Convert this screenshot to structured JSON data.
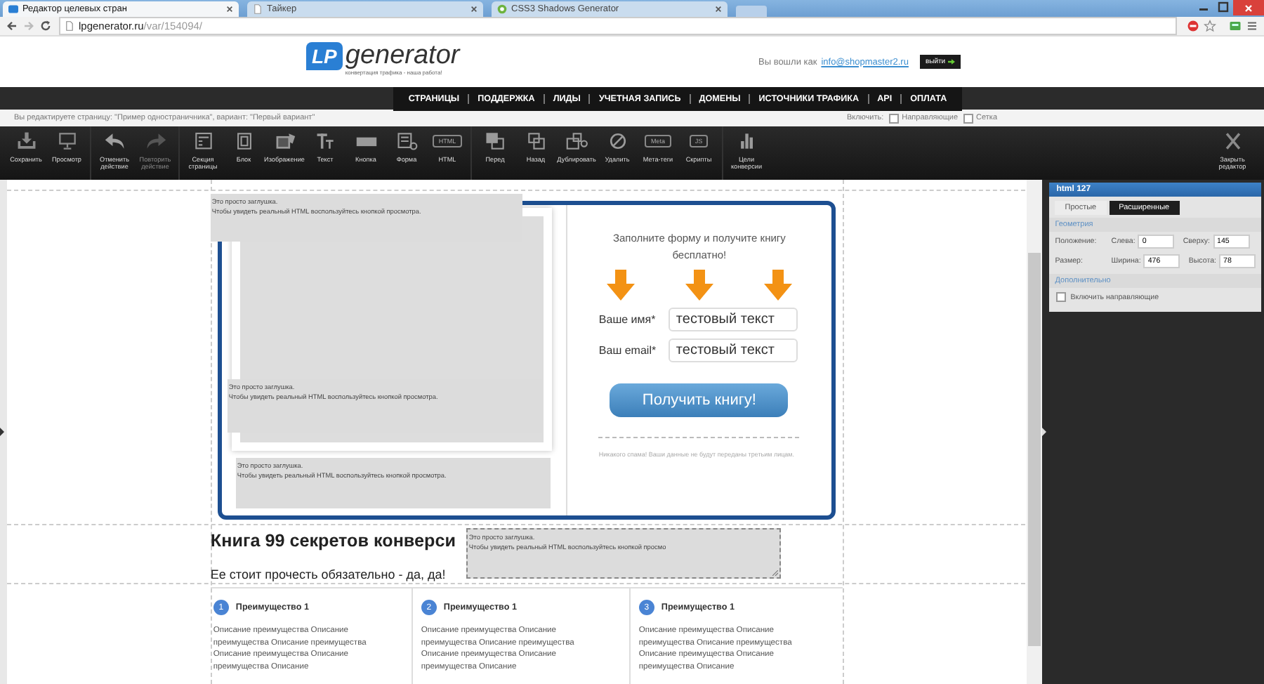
{
  "browser": {
    "tabs": [
      {
        "title": "Редактор целевых стран",
        "selected": true,
        "kind": "lp"
      },
      {
        "title": "Тайкер",
        "selected": false,
        "kind": "page"
      },
      {
        "title": "CSS3 Shadows Generator",
        "selected": false,
        "kind": "green"
      }
    ],
    "address": {
      "host": "lpgenerator.ru",
      "path": "/var/154094/"
    }
  },
  "header": {
    "logo": {
      "mark": "LP",
      "word": "generator",
      "tagline": "конвертация трафика - наша работа!"
    },
    "login_text": "Вы вошли как",
    "email": "info@shopmaster2.ru",
    "logout": "выйти"
  },
  "nav": [
    "СТРАНИЦЫ",
    "ПОДДЕРЖКА",
    "ЛИДЫ",
    "УЧЕТНАЯ ЗАПИСЬ",
    "ДОМЕНЫ",
    "ИСТОЧНИКИ ТРАФИКА",
    "API",
    "ОПЛАТА"
  ],
  "info": {
    "text": "Вы редактируете страницу: \"Пример одностраничника\", вариант: \"Первый вариант\"",
    "toggles_label": "Включить:",
    "toggles": [
      {
        "label": "Направляющие",
        "checked": false
      },
      {
        "label": "Сетка",
        "checked": false
      }
    ]
  },
  "toolbar": {
    "groups": [
      [
        {
          "kind": "save",
          "label": "Сохранить",
          "disabled": false
        },
        {
          "kind": "preview",
          "label": "Просмотр",
          "disabled": false
        }
      ],
      [
        {
          "kind": "undo",
          "label": "Отменить\nдействие",
          "disabled": false
        },
        {
          "kind": "redo",
          "label": "Повторить\nдействие",
          "disabled": true
        }
      ],
      [
        {
          "kind": "section",
          "label": "Секция\nстраницы",
          "disabled": false
        },
        {
          "kind": "block",
          "label": "Блок",
          "disabled": false
        },
        {
          "kind": "image",
          "label": "Изображение",
          "disabled": false
        },
        {
          "kind": "text",
          "label": "Текст",
          "disabled": false
        },
        {
          "kind": "button",
          "label": "Кнопка",
          "disabled": false
        },
        {
          "kind": "form",
          "label": "Форма",
          "disabled": false
        },
        {
          "kind": "badge",
          "badge": "HTML",
          "label": "HTML",
          "disabled": false
        }
      ],
      [
        {
          "kind": "front",
          "label": "Перед",
          "disabled": false
        },
        {
          "kind": "back",
          "label": "Назад",
          "disabled": false
        },
        {
          "kind": "duplicate",
          "label": "Дублировать",
          "disabled": false
        },
        {
          "kind": "delete",
          "label": "Удалить",
          "disabled": false
        },
        {
          "kind": "badge",
          "badge": "Meta",
          "label": "Мета-теги",
          "disabled": false
        },
        {
          "kind": "badge",
          "badge": "JS",
          "label": "Скрипты",
          "disabled": false
        }
      ],
      [
        {
          "kind": "chart",
          "label": "Цели\nконверсии",
          "disabled": false
        }
      ]
    ],
    "close": "Закрыть\nредактор"
  },
  "canvas": {
    "placeholders": [
      {
        "lines": [
          "Это просто заглушка.",
          "Чтобы увидеть реальный HTML воспользуйтесь кнопкой просмотра."
        ]
      },
      {
        "lines": [
          "Это просто заглушка.",
          "Чтобы увидеть реальный HTML воспользуйтесь кнопкой просмотра."
        ]
      },
      {
        "lines": [
          "Это просто заглушка.",
          "Чтобы увидеть реальный HTML воспользуйтесь кнопкой просмотра."
        ]
      }
    ],
    "selected_block": {
      "lines": [
        "Это просто заглушка.",
        "Чтобы увидеть реальный HTML воспользуйтесь кнопкой просмо"
      ]
    },
    "form": {
      "title": "Заполните форму и получите книгу бесплатно!",
      "fields": [
        {
          "label": "Ваше имя*",
          "value": "тестовый текст"
        },
        {
          "label": "Ваш email*",
          "value": "тестовый текст"
        }
      ],
      "button": "Получить книгу!",
      "note": "Никакого спама! Ваши данные не будут переданы третьим лицам."
    },
    "heading": "Книга 99 секретов конверси",
    "subheading": "Ее стоит прочесть обязательно - да, да!",
    "features": [
      {
        "number": "1",
        "title": "Преимущество 1",
        "text": "Описание преимущества Описание преимущества Описание преимущества Описание преимущества Описание преимущества Описание"
      },
      {
        "number": "2",
        "title": "Преимущество 1",
        "text": "Описание преимущества Описание преимущества Описание преимущества Описание преимущества Описание преимущества Описание"
      },
      {
        "number": "3",
        "title": "Преимущество 1",
        "text": "Описание преимущества Описание преимущества Описание преимущества Описание преимущества Описание преимущества Описание"
      }
    ]
  },
  "panel": {
    "title": "html 127",
    "tabs": [
      {
        "label": "Простые",
        "selected": false
      },
      {
        "label": "Расширенные",
        "selected": true
      }
    ],
    "geometry_title": "Геометрия",
    "rows": [
      {
        "label": "Положение:",
        "fields": [
          {
            "label": "Слева:",
            "value": "0"
          },
          {
            "label": "Сверху:",
            "value": "145"
          }
        ]
      },
      {
        "label": "Размер:",
        "fields": [
          {
            "label": "Ширина:",
            "value": "476"
          },
          {
            "label": "Высота:",
            "value": "78"
          }
        ]
      }
    ],
    "extra_title": "Дополнительно",
    "extra_option": {
      "label": "Включить направляющие",
      "checked": false
    }
  }
}
